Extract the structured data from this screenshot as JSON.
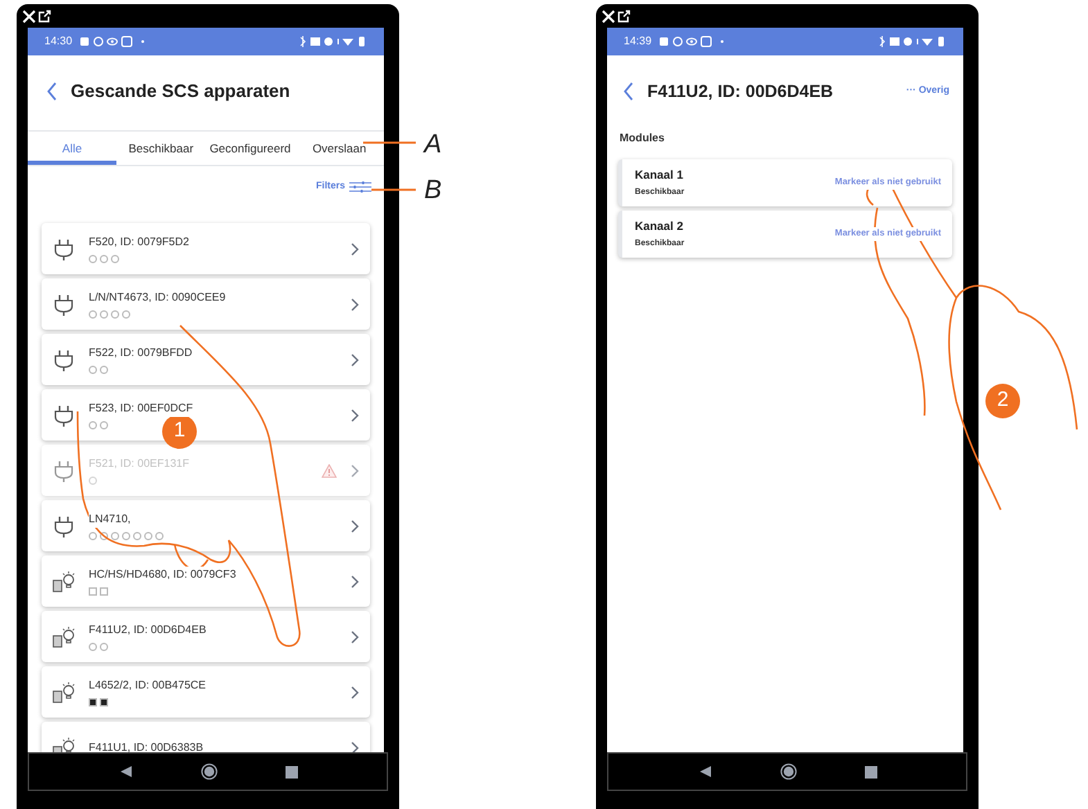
{
  "left_screen": {
    "status_time": "14:30",
    "title": "Gescande SCS apparaten",
    "tabs": [
      {
        "label": "Alle",
        "selected": true
      },
      {
        "label": "Beschikbaar",
        "selected": false
      },
      {
        "label": "Geconfigureerd",
        "selected": false
      },
      {
        "label": "Overslaan",
        "selected": false
      }
    ],
    "filter_label": "Filters",
    "devices": [
      {
        "kind": "plug",
        "label": "F520, ID: 0079F5D2",
        "disabled": false,
        "warning": false,
        "indicators": [
          {
            "kind": "circle",
            "filled": false
          },
          {
            "kind": "circle",
            "filled": false
          },
          {
            "kind": "circle",
            "filled": false
          }
        ]
      },
      {
        "kind": "plug",
        "label": "L/N/NT4673, ID: 0090CEE9",
        "disabled": false,
        "warning": false,
        "indicators": [
          {
            "kind": "circle",
            "filled": false
          },
          {
            "kind": "circle",
            "filled": false
          },
          {
            "kind": "circle",
            "filled": false
          },
          {
            "kind": "circle",
            "filled": false
          }
        ]
      },
      {
        "kind": "plug",
        "label": "F522, ID: 0079BFDD",
        "disabled": false,
        "warning": false,
        "indicators": [
          {
            "kind": "circle",
            "filled": false
          },
          {
            "kind": "circle",
            "filled": false
          }
        ]
      },
      {
        "kind": "plug",
        "label": "F523, ID: 00EF0DCF",
        "disabled": false,
        "warning": false,
        "indicators": [
          {
            "kind": "circle",
            "filled": false
          },
          {
            "kind": "circle",
            "filled": false
          }
        ]
      },
      {
        "kind": "plug",
        "label": "F521, ID: 00EF131F",
        "disabled": true,
        "warning": true,
        "indicators": [
          {
            "kind": "circle",
            "filled": false
          }
        ]
      },
      {
        "kind": "plug",
        "label": "LN4710,",
        "disabled": false,
        "warning": false,
        "indicators": [
          {
            "kind": "circle",
            "filled": false
          },
          {
            "kind": "circle",
            "filled": false
          },
          {
            "kind": "circle",
            "filled": false
          },
          {
            "kind": "circle",
            "filled": false
          },
          {
            "kind": "circle",
            "filled": false
          },
          {
            "kind": "circle",
            "filled": false
          },
          {
            "kind": "circle",
            "filled": false
          }
        ]
      },
      {
        "kind": "light",
        "label": "HC/HS/HD4680, ID: 0079CF3",
        "disabled": false,
        "warning": false,
        "indicators": [
          {
            "kind": "square",
            "filled": false
          },
          {
            "kind": "square",
            "filled": false
          }
        ]
      },
      {
        "kind": "light",
        "label": "F411U2, ID: 00D6D4EB",
        "disabled": false,
        "warning": false,
        "indicators": [
          {
            "kind": "circle",
            "filled": false
          },
          {
            "kind": "circle",
            "filled": false
          }
        ]
      },
      {
        "kind": "light",
        "label": "L4652/2, ID: 00B475CE",
        "disabled": false,
        "warning": false,
        "indicators": [
          {
            "kind": "square",
            "filled": true
          },
          {
            "kind": "square",
            "filled": true
          }
        ]
      },
      {
        "kind": "light",
        "label": "F411U1, ID: 00D6383B",
        "disabled": false,
        "warning": false
      }
    ]
  },
  "right_screen": {
    "status_time": "14:39",
    "title": "F411U2, ID: 00D6D4EB",
    "more_label": "··· Overig",
    "section_title": "Modules",
    "modules": [
      {
        "name": "Kanaal 1",
        "status": "Beschikbaar",
        "action": "Markeer als niet gebruikt"
      },
      {
        "name": "Kanaal 2",
        "status": "Beschikbaar",
        "action": "Markeer als niet gebruikt"
      }
    ]
  },
  "callouts": [
    "A",
    "B"
  ],
  "steps": [
    "1",
    "2"
  ]
}
